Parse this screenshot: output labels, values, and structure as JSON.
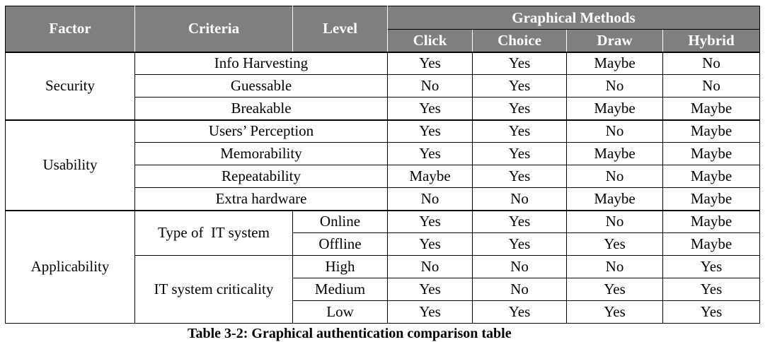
{
  "headers": {
    "factor": "Factor",
    "criteria": "Criteria",
    "level": "Level",
    "graphical_methods": "Graphical Methods",
    "methods": [
      "Click",
      "Choice",
      "Draw",
      "Hybrid"
    ]
  },
  "factors": {
    "security": "Security",
    "usability": "Usability",
    "applicability": "Applicability"
  },
  "criteria": {
    "info_harvesting": "Info Harvesting",
    "guessable": "Guessable",
    "breakable": "Breakable",
    "users_perception": "Users’ Perception",
    "memorability": "Memorability",
    "repeatability": "Repeatability",
    "extra_hardware": "Extra hardware",
    "type_of_it_system": "Type of  IT system",
    "it_system_criticality": "IT system criticality"
  },
  "levels": {
    "online": "Online",
    "offline": "Offline",
    "high": "High",
    "medium": "Medium",
    "low": "Low"
  },
  "values": {
    "info_harvesting": [
      "Yes",
      "Yes",
      "Maybe",
      "No"
    ],
    "guessable": [
      "No",
      "Yes",
      "No",
      "No"
    ],
    "breakable": [
      "Yes",
      "Yes",
      "Maybe",
      "Maybe"
    ],
    "users_perception": [
      "Yes",
      "Yes",
      "No",
      "Maybe"
    ],
    "memorability": [
      "Yes",
      "Yes",
      "Maybe",
      "Maybe"
    ],
    "repeatability": [
      "Maybe",
      "Yes",
      "No",
      "Maybe"
    ],
    "extra_hardware": [
      "No",
      "No",
      "Maybe",
      "Maybe"
    ],
    "online": [
      "Yes",
      "Yes",
      "No",
      "Maybe"
    ],
    "offline": [
      "Yes",
      "Yes",
      "Yes",
      "Maybe"
    ],
    "high": [
      "No",
      "No",
      "No",
      "Yes"
    ],
    "medium": [
      "Yes",
      "No",
      "Yes",
      "Yes"
    ],
    "low": [
      "Yes",
      "Yes",
      "Yes",
      "Yes"
    ]
  },
  "caption": "Table 3-2: Graphical authentication comparison table"
}
